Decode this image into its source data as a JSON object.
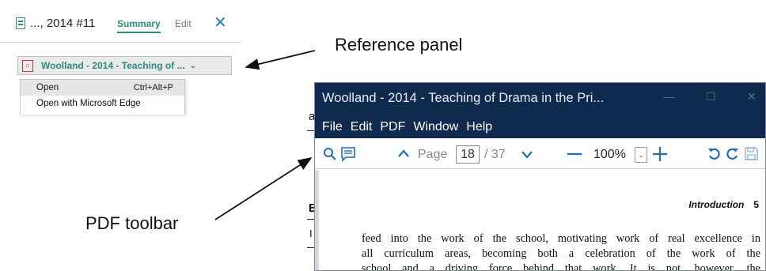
{
  "reference_panel": {
    "item_title": "..., 2014 #11",
    "tabs": {
      "summary": "Summary",
      "edit": "Edit"
    },
    "close_icon": "✕",
    "attachment_label": "Woolland - 2014 - Teaching of ...",
    "attachment_chevron": "⌄",
    "context_menu": [
      {
        "label": "Open",
        "shortcut": "Ctrl+Alt+P"
      },
      {
        "label": "Open with Microsoft Edge",
        "shortcut": ""
      }
    ],
    "colors": {
      "accent": "#2e8b7a",
      "close": "#1a7fbf",
      "pdf_red": "#c0392b"
    }
  },
  "background_fragments": {
    "left_a": "a",
    "left_e": "E",
    "left_i": "I"
  },
  "annotations": {
    "reference_panel": "Reference panel",
    "pdf_toolbar": "PDF toolbar"
  },
  "pdf_viewer": {
    "title": "Woolland - 2014 - Teaching of Drama in the Pri...",
    "window_controls": {
      "minimize": "—",
      "maximize": "☐",
      "close": "✕"
    },
    "menu": [
      "File",
      "Edit",
      "PDF",
      "Window",
      "Help"
    ],
    "toolbar": {
      "page_label": "Page",
      "page_current": "18",
      "page_total": "/ 37",
      "zoom": "100%",
      "zoom_dropdown": "⌄"
    },
    "content": {
      "running_head_title": "Introduction",
      "running_head_page": "5",
      "lines": [
        "feed into the work of the school, motivating work of real excellence in",
        "all curriculum areas, becoming both a celebration of the work of the",
        "school and a driving force behind that work. It is not, however, the"
      ]
    },
    "colors": {
      "titlebar": "#0f2a4e",
      "icon_blue": "#1f6fb8"
    }
  }
}
